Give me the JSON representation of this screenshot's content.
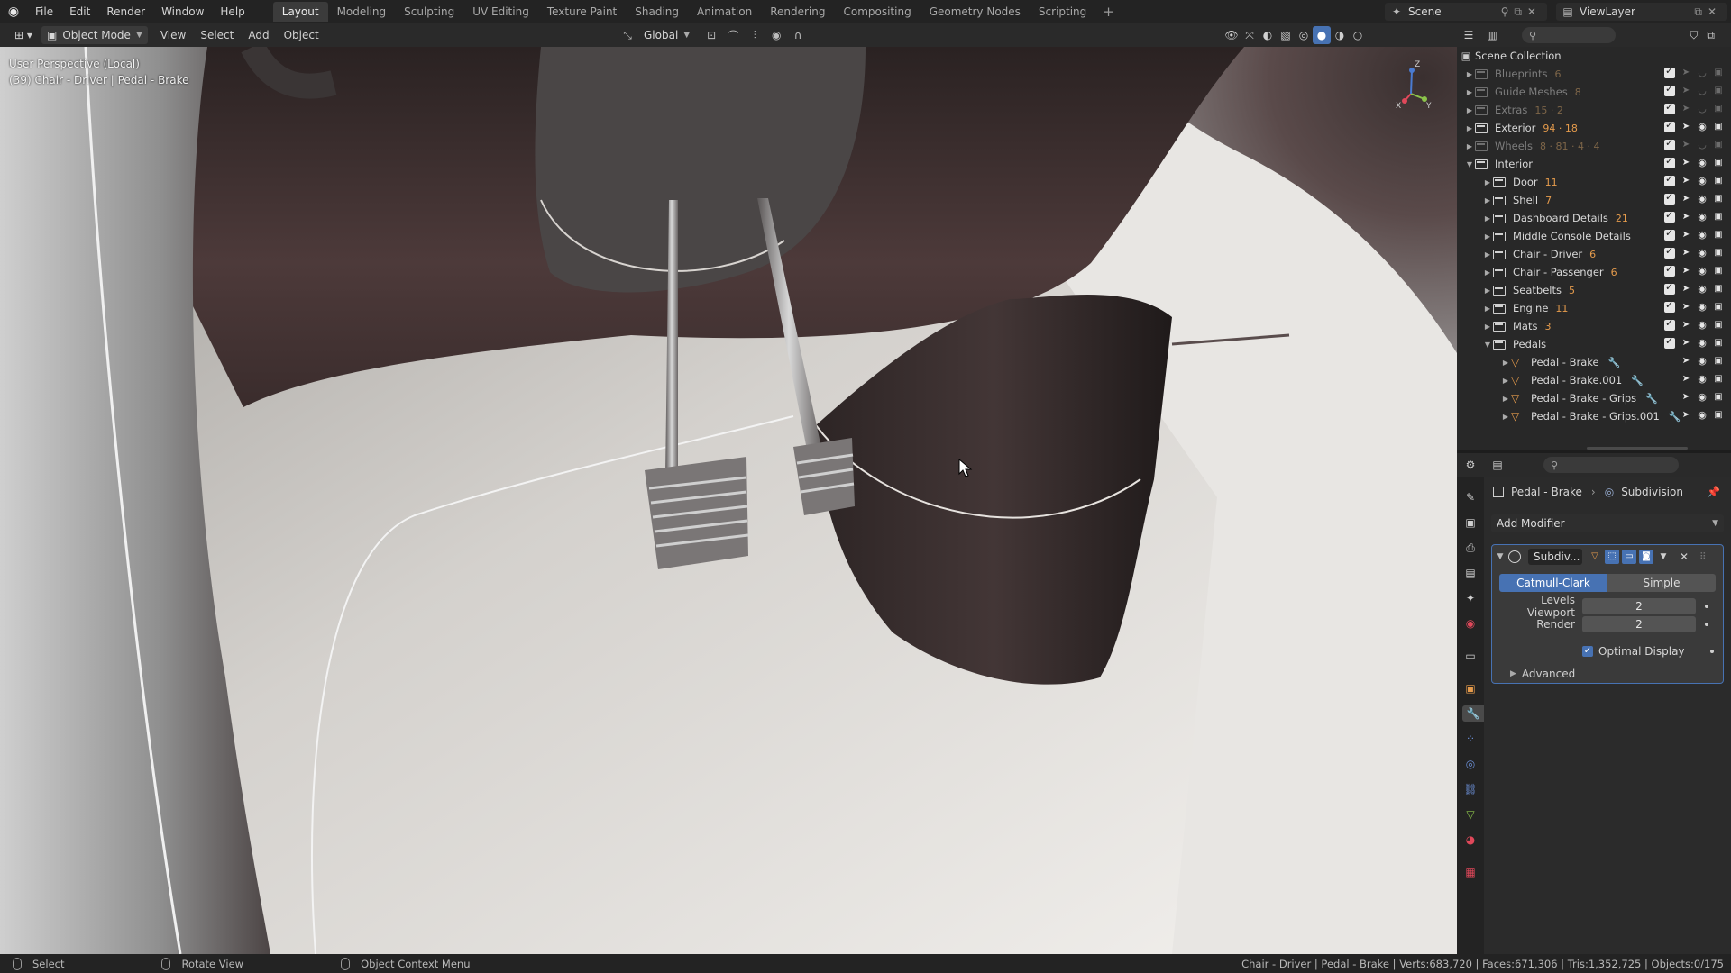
{
  "topbar": {
    "menus": [
      "File",
      "Edit",
      "Render",
      "Window",
      "Help"
    ],
    "workspaces": [
      {
        "label": "Layout",
        "active": true
      },
      {
        "label": "Modeling",
        "active": false
      },
      {
        "label": "Sculpting",
        "active": false
      },
      {
        "label": "UV Editing",
        "active": false
      },
      {
        "label": "Texture Paint",
        "active": false
      },
      {
        "label": "Shading",
        "active": false
      },
      {
        "label": "Animation",
        "active": false
      },
      {
        "label": "Rendering",
        "active": false
      },
      {
        "label": "Compositing",
        "active": false
      },
      {
        "label": "Geometry Nodes",
        "active": false
      },
      {
        "label": "Scripting",
        "active": false
      }
    ],
    "add_workspace": "+",
    "scene": "Scene",
    "view_layer": "ViewLayer"
  },
  "viewport_header": {
    "mode": "Object Mode",
    "menus": [
      "View",
      "Select",
      "Add",
      "Object"
    ],
    "transform_orientation": "Global"
  },
  "viewport": {
    "perspective_label": "User Perspective (Local)",
    "object_label": "(39) Chair - Driver | Pedal - Brake",
    "gizmo_axes": {
      "x": "X",
      "y": "Y",
      "z": "Z"
    }
  },
  "outliner": {
    "root": "Scene Collection",
    "rows": [
      {
        "label": "Blueprints",
        "depth": 0,
        "dim": true,
        "expanded": false,
        "badge": "6",
        "type": "collection"
      },
      {
        "label": "Guide Meshes",
        "depth": 0,
        "dim": true,
        "expanded": false,
        "badge": "8",
        "type": "collection"
      },
      {
        "label": "Extras",
        "depth": 0,
        "dim": true,
        "expanded": false,
        "badge": "15 · 2",
        "type": "collection"
      },
      {
        "label": "Exterior",
        "depth": 0,
        "dim": false,
        "expanded": false,
        "badge": "94 · 18",
        "type": "collection"
      },
      {
        "label": "Wheels",
        "depth": 0,
        "dim": true,
        "expanded": false,
        "badge": "8 · 81 · 4 · 4",
        "type": "collection"
      },
      {
        "label": "Interior",
        "depth": 0,
        "dim": false,
        "expanded": true,
        "badge": "",
        "type": "collection"
      },
      {
        "label": "Door",
        "depth": 1,
        "dim": false,
        "expanded": false,
        "badge": "11",
        "type": "collection"
      },
      {
        "label": "Shell",
        "depth": 1,
        "dim": false,
        "expanded": false,
        "badge": "7",
        "type": "collection"
      },
      {
        "label": "Dashboard Details",
        "depth": 1,
        "dim": false,
        "expanded": false,
        "badge": "21",
        "type": "collection"
      },
      {
        "label": "Middle Console Details",
        "depth": 1,
        "dim": false,
        "expanded": false,
        "badge": "",
        "type": "collection"
      },
      {
        "label": "Chair - Driver",
        "depth": 1,
        "dim": false,
        "expanded": false,
        "badge": "6",
        "type": "collection"
      },
      {
        "label": "Chair - Passenger",
        "depth": 1,
        "dim": false,
        "expanded": false,
        "badge": "6",
        "type": "collection"
      },
      {
        "label": "Seatbelts",
        "depth": 1,
        "dim": false,
        "expanded": false,
        "badge": "5",
        "type": "collection"
      },
      {
        "label": "Engine",
        "depth": 1,
        "dim": false,
        "expanded": false,
        "badge": "11",
        "type": "collection"
      },
      {
        "label": "Mats",
        "depth": 1,
        "dim": false,
        "expanded": false,
        "badge": "3",
        "type": "collection"
      },
      {
        "label": "Pedals",
        "depth": 1,
        "dim": false,
        "expanded": true,
        "badge": "",
        "type": "collection"
      },
      {
        "label": "Pedal - Brake",
        "depth": 2,
        "dim": false,
        "expanded": false,
        "badge": "",
        "type": "mesh"
      },
      {
        "label": "Pedal - Brake.001",
        "depth": 2,
        "dim": false,
        "expanded": false,
        "badge": "",
        "type": "mesh"
      },
      {
        "label": "Pedal - Brake - Grips",
        "depth": 2,
        "dim": false,
        "expanded": false,
        "badge": "",
        "type": "mesh"
      },
      {
        "label": "Pedal - Brake - Grips.001",
        "depth": 2,
        "dim": false,
        "expanded": false,
        "badge": "",
        "type": "mesh"
      }
    ]
  },
  "properties": {
    "breadcrumb_object": "Pedal - Brake",
    "breadcrumb_modifier": "Subdivision",
    "add_modifier": "Add Modifier",
    "modifier": {
      "name": "Subdiv...",
      "mode_catmull": "Catmull-Clark",
      "mode_simple": "Simple",
      "levels_viewport_label": "Levels Viewport",
      "levels_viewport": "2",
      "render_label": "Render",
      "render": "2",
      "optimal_display": "Optimal Display",
      "advanced": "Advanced"
    }
  },
  "statusbar": {
    "select": "Select",
    "rotate": "Rotate View",
    "context_menu": "Object Context Menu",
    "stats": "Chair - Driver | Pedal - Brake | Verts:683,720 | Faces:671,306 | Tris:1,352,725 | Objects:0/175"
  },
  "colors": {
    "accent": "#4772b3",
    "mesh_icon": "#e59b4c",
    "header": "#2a2a2a",
    "panel": "#282828"
  }
}
